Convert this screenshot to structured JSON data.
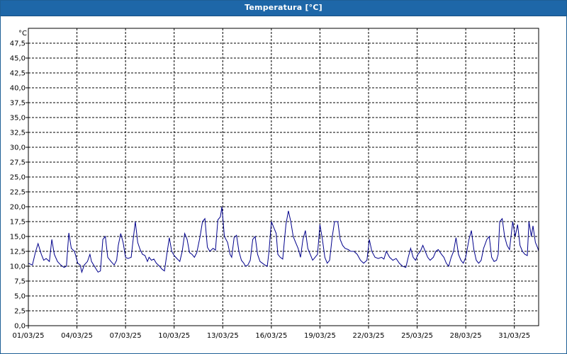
{
  "window": {
    "title": "Temperatura [°C]"
  },
  "chart_data": {
    "type": "line",
    "title": "Temperatura [°C]",
    "ylabel": "°C",
    "ylim": [
      0,
      50
    ],
    "yticks": [
      "0,0",
      "2,5",
      "5,0",
      "7,5",
      "10,0",
      "12,5",
      "15,0",
      "17,5",
      "20,0",
      "22,5",
      "25,0",
      "27,5",
      "30,0",
      "32,5",
      "35,0",
      "37,5",
      "40,0",
      "42,5",
      "45,0",
      "47,5"
    ],
    "xlim": [
      0,
      31.5
    ],
    "xticks": [
      {
        "x": 0,
        "label": "01/03/25"
      },
      {
        "x": 3,
        "label": "04/03/25"
      },
      {
        "x": 6,
        "label": "07/03/25"
      },
      {
        "x": 9,
        "label": "10/03/25"
      },
      {
        "x": 12,
        "label": "13/03/25"
      },
      {
        "x": 15,
        "label": "16/03/25"
      },
      {
        "x": 18,
        "label": "19/03/25"
      },
      {
        "x": 21,
        "label": "22/03/25"
      },
      {
        "x": 24,
        "label": "25/03/25"
      },
      {
        "x": 27,
        "label": "28/03/25"
      },
      {
        "x": 30,
        "label": "31/03/25"
      }
    ],
    "grid": true,
    "line_color": "#00008b",
    "series": [
      {
        "values": [
          [
            0.0,
            10.5
          ],
          [
            0.25,
            10.2
          ],
          [
            0.45,
            12.5
          ],
          [
            0.6,
            13.8
          ],
          [
            0.8,
            12.0
          ],
          [
            0.95,
            11.0
          ],
          [
            1.1,
            11.3
          ],
          [
            1.3,
            10.8
          ],
          [
            1.45,
            14.5
          ],
          [
            1.6,
            12.0
          ],
          [
            1.8,
            10.8
          ],
          [
            2.0,
            10.2
          ],
          [
            2.2,
            9.8
          ],
          [
            2.35,
            10.0
          ],
          [
            2.5,
            15.6
          ],
          [
            2.65,
            13.0
          ],
          [
            2.85,
            12.5
          ],
          [
            3.05,
            10.5
          ],
          [
            3.2,
            10.2
          ],
          [
            3.3,
            9.0
          ],
          [
            3.45,
            10.2
          ],
          [
            3.65,
            10.8
          ],
          [
            3.8,
            12.0
          ],
          [
            3.9,
            10.8
          ],
          [
            4.3,
            9.0
          ],
          [
            4.45,
            9.2
          ],
          [
            4.6,
            14.5
          ],
          [
            4.75,
            15.0
          ],
          [
            4.9,
            11.5
          ],
          [
            5.1,
            10.8
          ],
          [
            5.3,
            10.2
          ],
          [
            5.45,
            11.0
          ],
          [
            5.55,
            13.5
          ],
          [
            5.7,
            15.5
          ],
          [
            5.85,
            14.0
          ],
          [
            6.0,
            11.5
          ],
          [
            6.15,
            11.3
          ],
          [
            6.35,
            11.5
          ],
          [
            6.45,
            14.0
          ],
          [
            6.6,
            17.5
          ],
          [
            6.75,
            14.0
          ],
          [
            6.9,
            12.8
          ],
          [
            7.05,
            12.0
          ],
          [
            7.2,
            11.8
          ],
          [
            7.35,
            10.8
          ],
          [
            7.45,
            11.5
          ],
          [
            7.6,
            11.0
          ],
          [
            7.75,
            11.2
          ],
          [
            7.9,
            10.5
          ],
          [
            8.1,
            10.0
          ],
          [
            8.25,
            9.5
          ],
          [
            8.4,
            9.2
          ],
          [
            8.55,
            12.0
          ],
          [
            8.7,
            14.8
          ],
          [
            8.85,
            12.5
          ],
          [
            9.0,
            11.8
          ],
          [
            9.2,
            11.2
          ],
          [
            9.35,
            10.8
          ],
          [
            9.5,
            12.5
          ],
          [
            9.65,
            15.5
          ],
          [
            9.8,
            14.5
          ],
          [
            9.95,
            12.3
          ],
          [
            10.1,
            12.0
          ],
          [
            10.25,
            11.5
          ],
          [
            10.4,
            12.3
          ],
          [
            10.6,
            15.0
          ],
          [
            10.75,
            17.5
          ],
          [
            10.9,
            18.0
          ],
          [
            11.05,
            13.2
          ],
          [
            11.2,
            12.5
          ],
          [
            11.4,
            13.0
          ],
          [
            11.55,
            12.7
          ],
          [
            11.7,
            17.8
          ],
          [
            11.85,
            18.3
          ],
          [
            11.95,
            20.0
          ],
          [
            12.1,
            15.0
          ],
          [
            12.3,
            14.0
          ],
          [
            12.45,
            12.0
          ],
          [
            12.55,
            11.5
          ],
          [
            12.7,
            14.8
          ],
          [
            12.85,
            15.2
          ],
          [
            13.0,
            12.5
          ],
          [
            13.15,
            11.0
          ],
          [
            13.3,
            10.5
          ],
          [
            13.4,
            10.0
          ],
          [
            13.55,
            10.2
          ],
          [
            13.7,
            11.0
          ],
          [
            13.85,
            14.5
          ],
          [
            14.0,
            15.0
          ],
          [
            14.15,
            12.0
          ],
          [
            14.3,
            10.8
          ],
          [
            14.45,
            10.5
          ],
          [
            14.6,
            10.2
          ],
          [
            14.75,
            10.0
          ],
          [
            14.85,
            12.3
          ],
          [
            15.0,
            17.5
          ],
          [
            15.15,
            16.5
          ],
          [
            15.3,
            15.5
          ],
          [
            15.4,
            12.0
          ],
          [
            15.55,
            11.5
          ],
          [
            15.7,
            11.2
          ],
          [
            15.9,
            17.0
          ],
          [
            16.05,
            19.3
          ],
          [
            16.2,
            17.5
          ],
          [
            16.35,
            15.0
          ],
          [
            16.5,
            14.0
          ],
          [
            16.65,
            13.0
          ],
          [
            16.8,
            11.5
          ],
          [
            16.95,
            14.5
          ],
          [
            17.1,
            16.0
          ],
          [
            17.25,
            13.0
          ],
          [
            17.4,
            12.0
          ],
          [
            17.55,
            11.0
          ],
          [
            17.7,
            11.5
          ],
          [
            17.85,
            12.0
          ],
          [
            18.0,
            17.0
          ],
          [
            18.15,
            14.5
          ],
          [
            18.3,
            11.5
          ],
          [
            18.45,
            10.5
          ],
          [
            18.6,
            11.0
          ],
          [
            18.75,
            14.8
          ],
          [
            18.9,
            17.5
          ],
          [
            19.1,
            17.5
          ],
          [
            19.25,
            14.5
          ],
          [
            19.4,
            13.5
          ],
          [
            19.55,
            13.0
          ],
          [
            19.75,
            12.8
          ],
          [
            19.9,
            12.5
          ],
          [
            20.1,
            12.5
          ],
          [
            20.3,
            12.0
          ],
          [
            20.5,
            11.0
          ],
          [
            20.7,
            10.5
          ],
          [
            20.9,
            11.0
          ],
          [
            21.05,
            14.5
          ],
          [
            21.2,
            12.5
          ],
          [
            21.4,
            11.5
          ],
          [
            21.6,
            11.3
          ],
          [
            21.8,
            11.5
          ],
          [
            21.95,
            11.2
          ],
          [
            22.1,
            12.5
          ],
          [
            22.3,
            11.5
          ],
          [
            22.5,
            11.0
          ],
          [
            22.7,
            11.3
          ],
          [
            22.9,
            10.5
          ],
          [
            23.1,
            10.0
          ],
          [
            23.3,
            9.8
          ],
          [
            23.45,
            11.5
          ],
          [
            23.6,
            13.0
          ],
          [
            23.75,
            11.5
          ],
          [
            23.9,
            11.0
          ],
          [
            24.05,
            12.0
          ],
          [
            24.2,
            12.5
          ],
          [
            24.35,
            13.5
          ],
          [
            24.5,
            12.5
          ],
          [
            24.65,
            11.5
          ],
          [
            24.8,
            11.0
          ],
          [
            25.0,
            11.5
          ],
          [
            25.15,
            12.5
          ],
          [
            25.3,
            12.8
          ],
          [
            25.5,
            12.0
          ],
          [
            25.65,
            11.5
          ],
          [
            25.8,
            10.5
          ],
          [
            25.95,
            10.0
          ],
          [
            26.1,
            11.5
          ],
          [
            26.25,
            12.5
          ],
          [
            26.4,
            14.8
          ],
          [
            26.55,
            12.0
          ],
          [
            26.7,
            11.0
          ],
          [
            26.85,
            10.5
          ],
          [
            27.0,
            11.5
          ],
          [
            27.2,
            14.5
          ],
          [
            27.35,
            16.0
          ],
          [
            27.5,
            12.8
          ],
          [
            27.65,
            11.0
          ],
          [
            27.8,
            10.5
          ],
          [
            27.95,
            11.0
          ],
          [
            28.1,
            13.0
          ],
          [
            28.3,
            14.5
          ],
          [
            28.45,
            15.0
          ],
          [
            28.6,
            11.5
          ],
          [
            28.75,
            10.8
          ],
          [
            28.9,
            11.0
          ],
          [
            29.0,
            12.0
          ],
          [
            29.1,
            17.5
          ],
          [
            29.25,
            18.0
          ],
          [
            29.4,
            15.0
          ],
          [
            29.55,
            13.5
          ],
          [
            29.7,
            12.8
          ],
          [
            29.9,
            17.5
          ],
          [
            30.05,
            15.0
          ],
          [
            30.2,
            17.0
          ],
          [
            30.35,
            13.5
          ],
          [
            30.5,
            12.5
          ],
          [
            30.65,
            12.0
          ],
          [
            30.8,
            11.8
          ],
          [
            30.9,
            17.5
          ],
          [
            31.05,
            15.0
          ],
          [
            31.15,
            16.8
          ],
          [
            31.3,
            14.0
          ],
          [
            31.45,
            13.0
          ],
          [
            31.5,
            12.5
          ]
        ]
      }
    ]
  }
}
